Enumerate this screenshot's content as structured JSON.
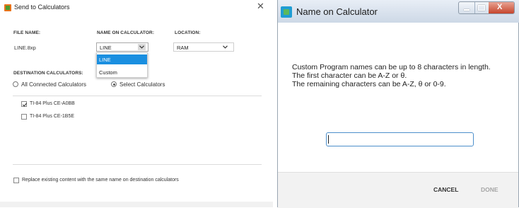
{
  "send_dialog": {
    "title": "Send to Calculators",
    "icons": {
      "app": "app-icon",
      "close": "close-icon"
    },
    "headers": {
      "file_name": "FILE NAME:",
      "name_on_calculator": "NAME ON CALCULATOR:",
      "location": "LOCATION:"
    },
    "file_name_value": "LINE.8xp",
    "name_select": {
      "selected": "LINE",
      "options": [
        "LINE",
        "Custom"
      ]
    },
    "location_select": {
      "selected": "RAM"
    },
    "destination": {
      "header": "DESTINATION CALCULATORS:",
      "all_label": "All Connected Calculators",
      "select_label": "Select Calculators",
      "calculators": [
        {
          "name": "TI-84 Plus CE-A0BB",
          "checked": true
        },
        {
          "name": "TI-84 Plus CE-1B5E",
          "checked": false
        }
      ]
    },
    "replace_label": "Replace existing content with the same name on destination calculators",
    "accent": "#1a8fe0"
  },
  "name_dialog": {
    "title": "Name on Calculator",
    "message_lines": [
      "Custom Program names can be up to 8 characters in length.",
      "The first character can be A-Z or θ.",
      "The remaining characters can be A-Z, θ or 0-9."
    ],
    "input_value": "",
    "cancel_label": "CANCEL",
    "done_label": "DONE",
    "icons": {
      "app": "app-icon",
      "minimize": "minimize-icon",
      "maximize": "maximize-icon",
      "close": "close-icon"
    }
  }
}
